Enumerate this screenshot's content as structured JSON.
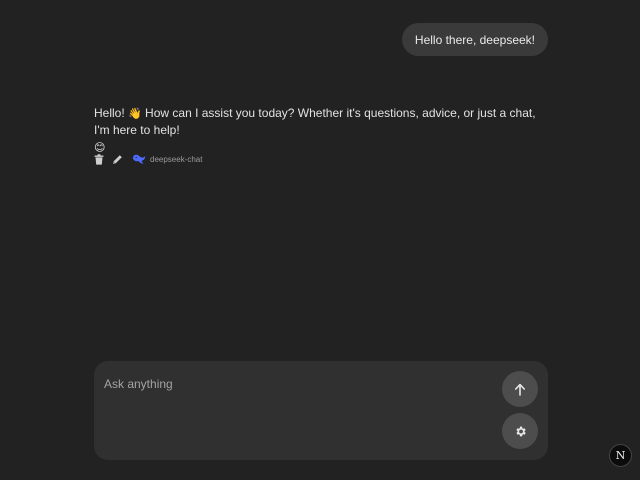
{
  "conversation": {
    "user_message": "Hello there, deepseek!",
    "assistant_message": {
      "text_before_emoji": "Hello! ",
      "wave_emoji": "👋",
      "text_after_emoji": " How can I assist you today? Whether it's questions, advice, or just a chat, I'm here to help! ",
      "smile_emoji": "😊"
    },
    "actions": {
      "delete_icon": "trash-icon",
      "edit_icon": "pencil-icon",
      "model_icon": "deepseek-whale-icon",
      "model_name": "deepseek-chat"
    }
  },
  "composer": {
    "placeholder": "Ask anything",
    "value": "",
    "send_icon": "arrow-up-icon",
    "settings_icon": "gear-icon"
  },
  "dev_badge": {
    "label": "N"
  },
  "colors": {
    "background": "#222222",
    "bubble": "#3a3a3a",
    "composer": "#303030",
    "button": "#4d4d4d",
    "model_icon": "#4d6bfe"
  }
}
